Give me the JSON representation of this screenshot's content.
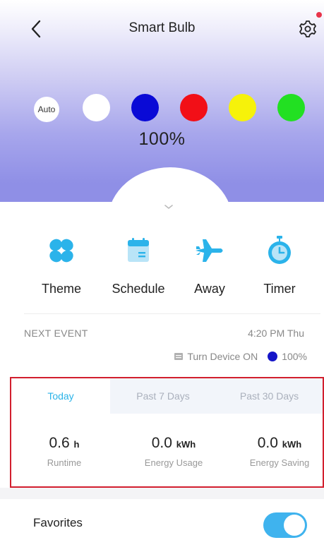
{
  "header": {
    "title": "Smart Bulb",
    "back_icon": "chevron-left-icon",
    "settings_icon": "gear-icon",
    "notification_dot_color": "#e8344a"
  },
  "colors": {
    "auto_label": "Auto",
    "swatches": [
      {
        "name": "white",
        "hex": "#ffffff"
      },
      {
        "name": "blue",
        "hex": "#0a0ad6"
      },
      {
        "name": "red",
        "hex": "#f20f17"
      },
      {
        "name": "yellow",
        "hex": "#f6f20a"
      },
      {
        "name": "green",
        "hex": "#22e022"
      }
    ]
  },
  "brightness": "100%",
  "features": [
    {
      "label": "Theme",
      "icon": "theme-icon"
    },
    {
      "label": "Schedule",
      "icon": "calendar-icon"
    },
    {
      "label": "Away",
      "icon": "airplane-icon"
    },
    {
      "label": "Timer",
      "icon": "timer-icon"
    }
  ],
  "next_event": {
    "label": "NEXT EVENT",
    "time": "4:20 PM  Thu",
    "action": "Turn Device ON",
    "level": "100%"
  },
  "usage": {
    "tabs": [
      {
        "label": "Today",
        "active": true
      },
      {
        "label": "Past 7 Days",
        "active": false
      },
      {
        "label": "Past 30 Days",
        "active": false
      }
    ],
    "stats": [
      {
        "value": "0.6",
        "unit": "h",
        "label": "Runtime"
      },
      {
        "value": "0.0",
        "unit": "kWh",
        "label": "Energy Usage"
      },
      {
        "value": "0.0",
        "unit": "kWh",
        "label": "Energy Saving"
      }
    ]
  },
  "favorites": {
    "label": "Favorites",
    "enabled": true
  },
  "accent_color": "#3fb3ee"
}
